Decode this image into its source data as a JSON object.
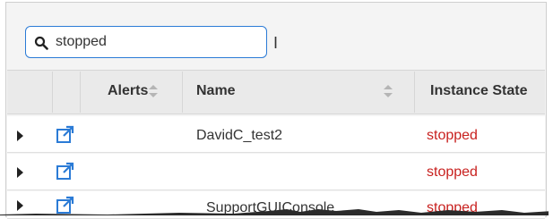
{
  "search": {
    "value": "stopped"
  },
  "table": {
    "headers": {
      "alerts": "Alerts",
      "name": "Name",
      "instance_state": "Instance State"
    },
    "rows": [
      {
        "name": "DavidC_test2",
        "state": "stopped"
      },
      {
        "name": "",
        "state": "stopped"
      },
      {
        "name": "SupportGUIConsole",
        "state": "stopped"
      }
    ]
  },
  "colors": {
    "accent": "#2b7bd6",
    "stopped": "#c8211f",
    "link_icon": "#2b7bd6"
  },
  "icons": [
    "search-icon",
    "text-cursor-icon",
    "sort-icon",
    "expand-triangle-icon",
    "external-link-icon"
  ]
}
